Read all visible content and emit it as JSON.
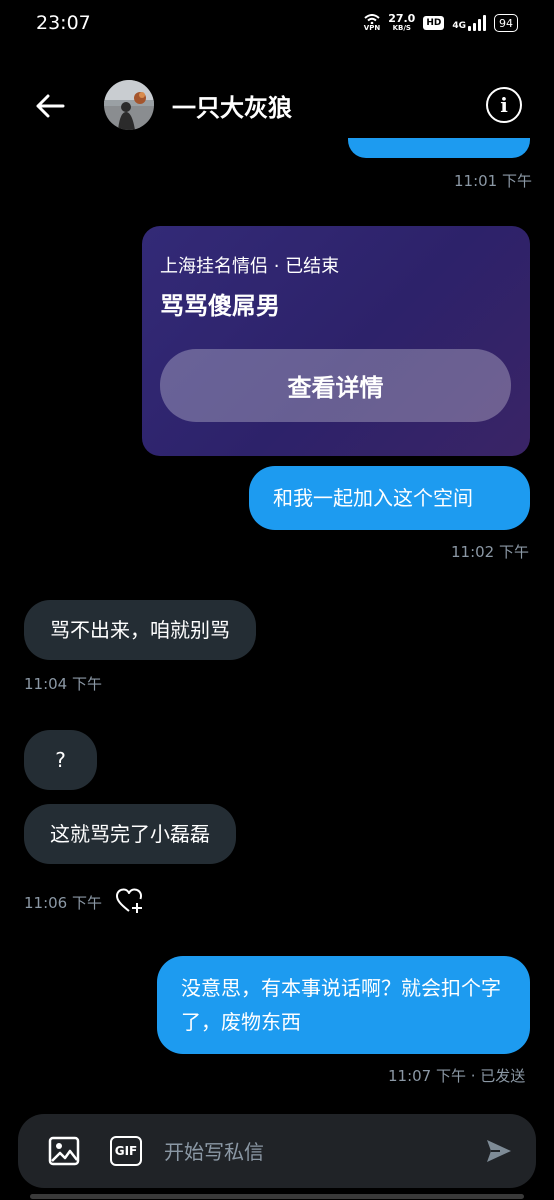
{
  "status_bar": {
    "time": "23:07",
    "vpn_label": "VPN",
    "speed_value": "27.0",
    "speed_unit": "KB/S",
    "hd_label": "HD",
    "network_label": "4G",
    "battery": "94"
  },
  "header": {
    "contact_name": "一只大灰狼",
    "back_icon": "back-arrow-icon",
    "info_icon": "info-icon",
    "info_glyph": "i"
  },
  "messages": {
    "ts1": "11:01 下午",
    "card": {
      "subtitle": "上海挂名情侣 · 已结束",
      "title": "骂骂傻屌男",
      "button": "查看详情"
    },
    "m1": "和我一起加入这个空间",
    "ts2": "11:02 下午",
    "m2": "骂不出来，咱就别骂",
    "ts3": "11:04 下午",
    "m3": "?",
    "m4": "这就骂完了小磊磊",
    "ts4": "11:06 下午",
    "m5": "没意思，有本事说话啊？就会扣个字了，废物东西",
    "ts5": "11:07 下午 · 已发送"
  },
  "composer": {
    "placeholder": "开始写私信",
    "gif_label": "GIF",
    "image_icon": "image-icon",
    "send_icon": "send-icon"
  },
  "colors": {
    "outgoing_bubble": "#1d9bf0",
    "incoming_bubble": "#242d34",
    "timestamp": "#8b98a5",
    "background": "#000000"
  }
}
